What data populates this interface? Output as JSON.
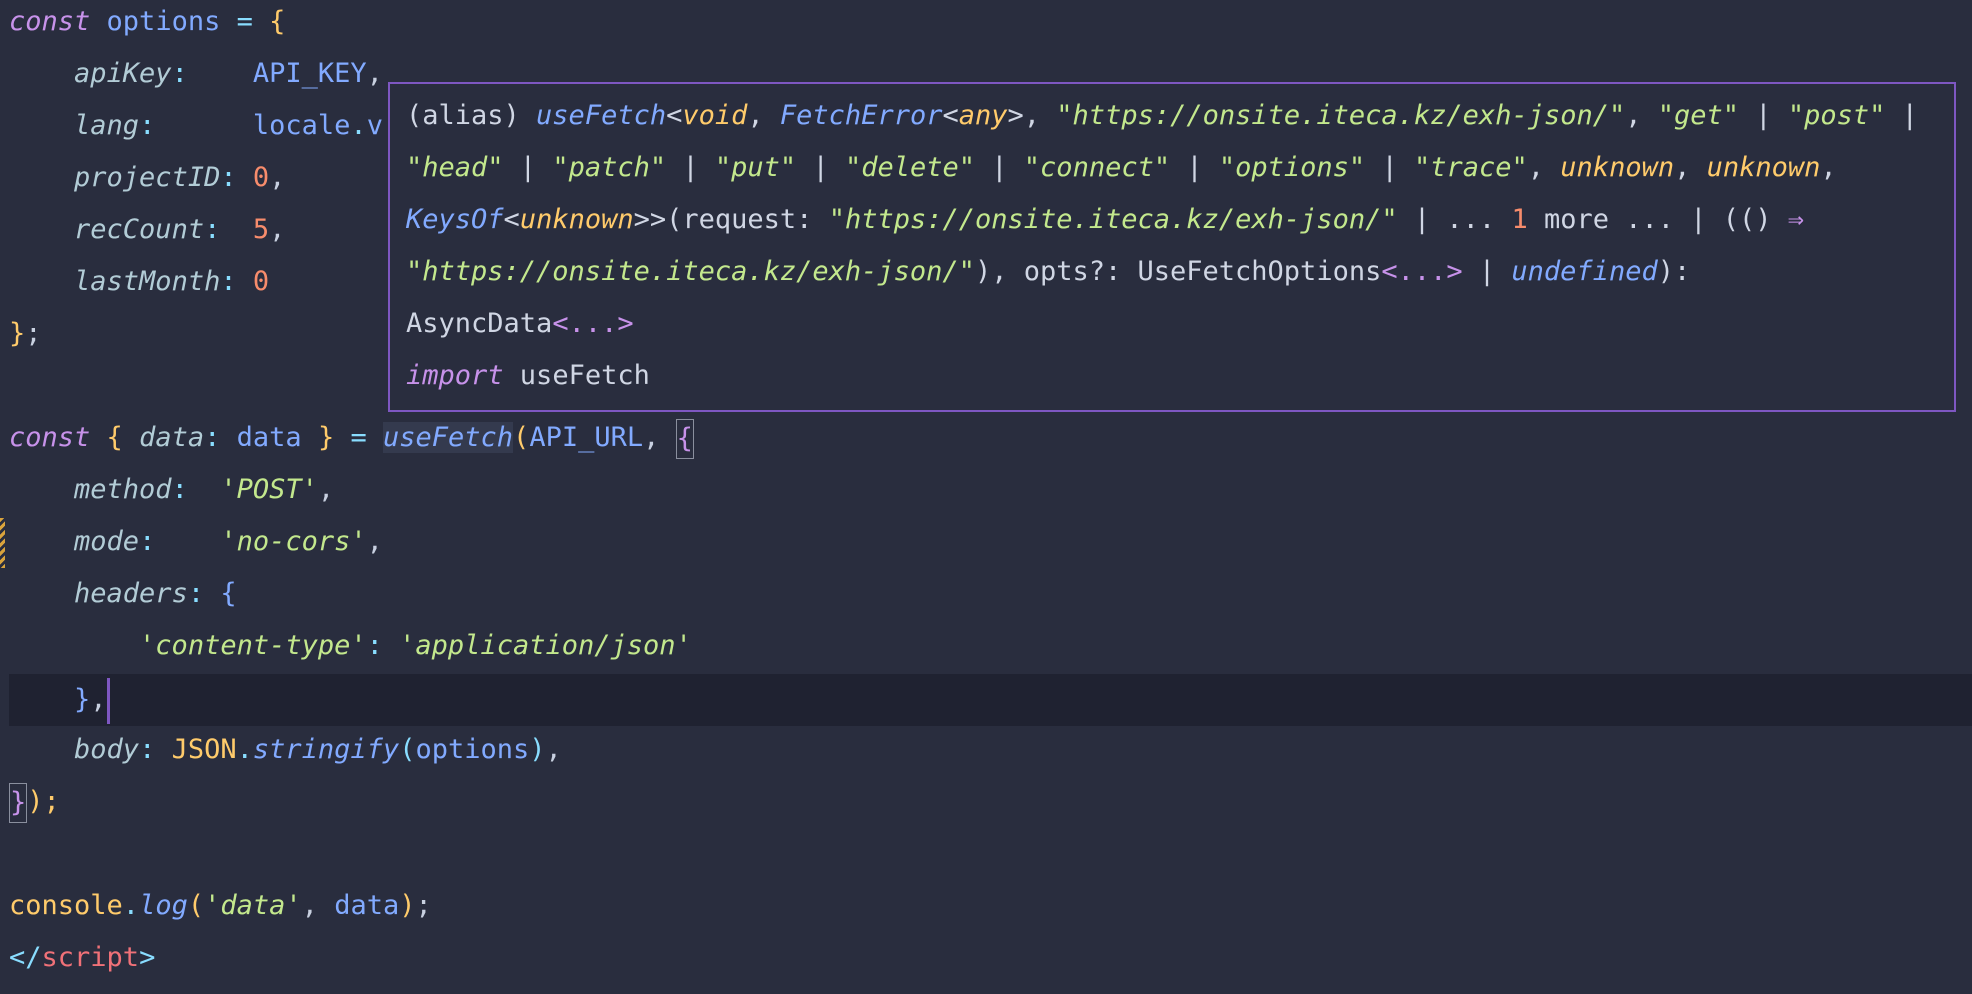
{
  "code": {
    "l1": {
      "kw": "const",
      "name": "options",
      "eq": "=",
      "brace": "{"
    },
    "l2": {
      "key": "apiKey",
      "colon": ":",
      "value": "API_KEY",
      "comma": ","
    },
    "l3": {
      "key": "lang",
      "colon": ":",
      "obj": "locale",
      "dot": ".",
      "rest": "v"
    },
    "l4": {
      "key": "projectID",
      "colon": ":",
      "value": "0",
      "comma": ","
    },
    "l5": {
      "key": "recCount",
      "colon": ":",
      "value": "5",
      "comma": ","
    },
    "l6": {
      "key": "lastMonth",
      "colon": ":",
      "value": "0"
    },
    "l7": {
      "brace": "}",
      "semi": ";"
    },
    "l9": {
      "kw": "const",
      "open": "{",
      "key": "data",
      "colon": ":",
      "value": "data",
      "close": "}",
      "eq": "=",
      "fn": "useFetch",
      "paren": "(",
      "arg": "API_URL",
      "comma": ",",
      "brace": "{"
    },
    "l10": {
      "key": "method",
      "colon": ":",
      "value": "'POST'",
      "comma": ","
    },
    "l11": {
      "key": "mode",
      "colon": ":",
      "value": "'no-cors'",
      "comma": ","
    },
    "l12": {
      "key": "headers",
      "colon": ":",
      "brace": "{"
    },
    "l13": {
      "key": "'content-type'",
      "colon": ":",
      "value": "'application/json'"
    },
    "l14": {
      "brace": "}",
      "comma": ","
    },
    "l15": {
      "key": "body",
      "colon": ":",
      "obj": "JSON",
      "dot": ".",
      "fn": "stringify",
      "open": "(",
      "arg": "options",
      "close": ")",
      "comma": ","
    },
    "l16": {
      "brace": "}",
      "rest": ");"
    },
    "l18": {
      "obj": "console",
      "dot": ".",
      "fn": "log",
      "open": "(",
      "str": "'data'",
      "comma": ",",
      "arg": "data",
      "close": ")",
      "semi": ";"
    },
    "l19": {
      "lt": "</",
      "tag": "script",
      "gt": ">"
    }
  },
  "hover": {
    "r1": {
      "alias": "(alias) ",
      "fn": "useFetch",
      "lt": "<",
      "void": "void",
      "sep1": ", ",
      "fetchError": "FetchError",
      "lt2": "<",
      "any": "any",
      "gt2": ">",
      "sep2": ", ",
      "url": "\"https://onsite.iteca.kz/exh-json/\"",
      "sep3": ", ",
      "get": "\"get\"",
      "pipe1": " | ",
      "post": "\"post\"",
      "pipe2": " |"
    },
    "r2": {
      "head": "\"head\"",
      "pipe1": " | ",
      "patch": "\"patch\"",
      "pipe2": " | ",
      "put": "\"put\"",
      "pipe3": " | ",
      "delete": "\"delete\"",
      "pipe4": " | ",
      "connect": "\"connect\"",
      "pipe5": " | ",
      "options": "\"options\"",
      "pipe6": " | ",
      "trace": "\"trace\"",
      "sep1": ", ",
      "unknown1": "unknown",
      "sep2": ", ",
      "unknown2": "unknown",
      "sep3": ","
    },
    "r3": {
      "keysOf": "KeysOf",
      "lt": "<",
      "unknown": "unknown",
      "close": ">>(request: ",
      "url": "\"https://onsite.iteca.kz/exh-json/\"",
      "mid": " | ... ",
      "num": "1",
      "more": " more ... | (() ",
      "arrow": "⇒"
    },
    "r4": {
      "url": "\"https://onsite.iteca.kz/exh-json/\"",
      "mid": "), opts?: UseFetchOptions",
      "ell": "<...>",
      "pipe": " | ",
      "undef": "undefined",
      "end": "):"
    },
    "r5": {
      "type": "AsyncData",
      "ell": "<...>"
    },
    "r6": {
      "kw": "import",
      "name": " useFetch"
    }
  }
}
